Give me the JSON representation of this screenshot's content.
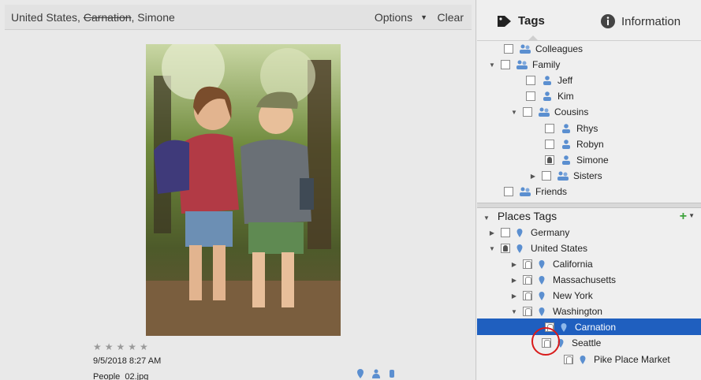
{
  "filter": {
    "crumb_1": "United States, ",
    "crumb_struck": "Carnation",
    "crumb_2": ", Simone",
    "options_label": "Options",
    "clear_label": "Clear"
  },
  "photo_meta": {
    "stars": "★★★★★",
    "datetime": "9/5/2018 8:27 AM",
    "filename": "People_02.jpg"
  },
  "tabs": {
    "tags": "Tags",
    "information": "Information"
  },
  "people_tags": [
    {
      "label": "Colleagues"
    },
    {
      "label": "Family"
    },
    {
      "label": "Jeff"
    },
    {
      "label": "Kim"
    },
    {
      "label": "Cousins"
    },
    {
      "label": "Rhys"
    },
    {
      "label": "Robyn"
    },
    {
      "label": "Simone"
    },
    {
      "label": "Sisters"
    },
    {
      "label": "Friends"
    }
  ],
  "places": {
    "header": "Places Tags",
    "add_label": "+",
    "items": [
      {
        "label": "Germany"
      },
      {
        "label": "United States"
      },
      {
        "label": "California"
      },
      {
        "label": "Massachusetts"
      },
      {
        "label": "New York"
      },
      {
        "label": "Washington"
      },
      {
        "label": "Carnation"
      },
      {
        "label": "Seattle"
      },
      {
        "label": "Pike Place Market"
      }
    ]
  },
  "colors": {
    "selection": "#1f5fbf",
    "add_green": "#3ca23a",
    "highlight_circle": "#d81b1b",
    "tag_icon_blue": "#5b8fd0"
  }
}
